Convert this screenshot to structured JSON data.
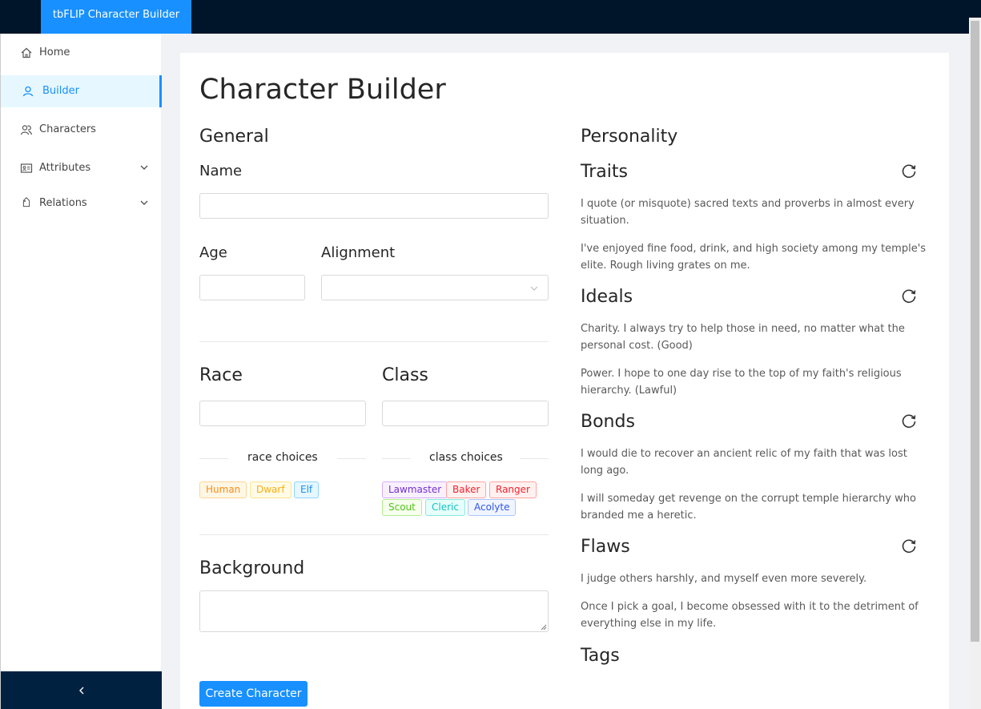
{
  "app": {
    "title": "tbFLIP Character Builder"
  },
  "menu": {
    "items": [
      {
        "label": "Home",
        "icon": "home-icon"
      },
      {
        "label": "Builder",
        "icon": "user-icon"
      },
      {
        "label": "Characters",
        "icon": "team-icon"
      },
      {
        "label": "Attributes",
        "icon": "idcard-icon"
      },
      {
        "label": "Relations",
        "icon": "tag-icon"
      }
    ],
    "selected": "Builder"
  },
  "page": {
    "title": "Character Builder"
  },
  "form": {
    "general": "General",
    "name_label": "Name",
    "age_label": "Age",
    "alignment_label": "Alignment",
    "race_label": "Race",
    "class_label": "Class",
    "race_choices": "race choices",
    "class_choices": "class choices",
    "background_label": "Background",
    "submit": "Create Character",
    "races": [
      "Human",
      "Dwarf",
      "Elf"
    ],
    "classes": [
      "Lawmaster",
      "Baker",
      "Ranger",
      "Scout",
      "Cleric",
      "Acolyte"
    ]
  },
  "personality": {
    "title": "Personality",
    "traits": {
      "label": "Traits",
      "items": [
        "I quote (or misquote) sacred texts and proverbs in almost every situation.",
        "I've enjoyed fine food, drink, and high society among my temple's elite. Rough living grates on me."
      ]
    },
    "ideals": {
      "label": "Ideals",
      "items": [
        "Charity. I always try to help those in need, no matter what the personal cost. (Good)",
        "Power. I hope to one day rise to the top of my faith's religious hierarchy. (Lawful)"
      ]
    },
    "bonds": {
      "label": "Bonds",
      "items": [
        "I would die to recover an ancient relic of my faith that was lost long ago.",
        "I will someday get revenge on the corrupt temple hierarchy who branded me a heretic."
      ]
    },
    "flaws": {
      "label": "Flaws",
      "items": [
        "I judge others harshly, and myself even more severely.",
        "Once I pick a goal, I become obsessed with it to the detriment of everything else in my life."
      ]
    },
    "tags_label": "Tags"
  },
  "colors": {
    "accent": "#1890ff",
    "header": "#001529"
  }
}
